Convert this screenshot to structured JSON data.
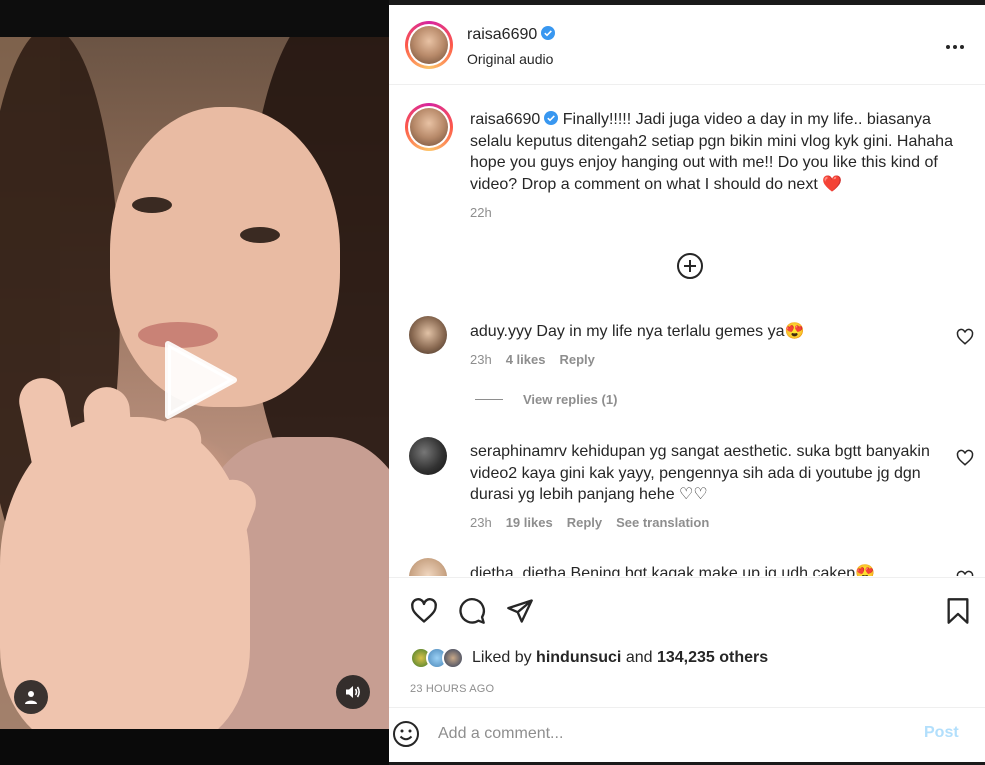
{
  "author": {
    "username": "raisa6690",
    "audio": "Original audio"
  },
  "caption": {
    "username": "raisa6690",
    "text": "Finally!!!!! Jadi juga video a day in my life.. biasanya selalu keputus ditengah2 setiap pgn bikin mini vlog kyk gini. Hahaha hope you guys enjoy hanging out with me!! Do you like this kind of video? Drop a comment on what I should do next ❤️",
    "time": "22h"
  },
  "comments": [
    {
      "username": "aduy.yyy",
      "text": "Day in my life nya terlalu gemes ya😍",
      "time": "23h",
      "likes": "4 likes",
      "reply": "Reply",
      "view_replies": "View replies (1)"
    },
    {
      "username": "seraphinamrv",
      "text": "kehidupan yg sangat aesthetic. suka bgtt banyakin video2 kaya gini kak yayy, pengennya sih ada di youtube jg dgn durasi yg lebih panjang hehe ♡♡",
      "time": "23h",
      "likes": "19 likes",
      "reply": "Reply",
      "translation": "See translation"
    },
    {
      "username": "dietha_dietha",
      "text": "Bening bgt kagak make up jg udh cakep😍"
    }
  ],
  "likes": {
    "prefix": "Liked by",
    "liker": "hindunsuci",
    "and": "and",
    "others": "134,235 others"
  },
  "post_time": "23 HOURS AGO",
  "comment_box": {
    "placeholder": "Add a comment...",
    "post_label": "Post"
  },
  "colors": {
    "verified": "#3897f0",
    "link_disabled": "#b2dffc",
    "secondary_text": "#8e8e8e"
  },
  "icons": [
    "play-icon",
    "user-tag-icon",
    "volume-icon",
    "verified-icon",
    "more-icon",
    "add-circle-icon",
    "heart-icon",
    "comment-icon",
    "share-icon",
    "bookmark-icon",
    "emoji-icon"
  ]
}
